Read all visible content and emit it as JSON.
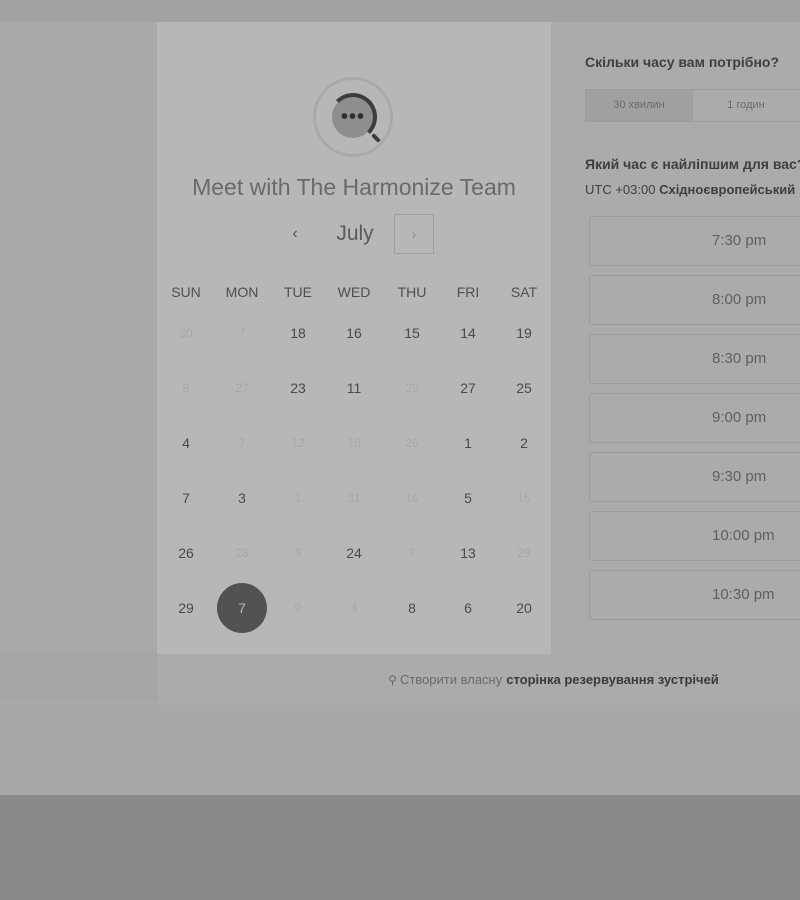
{
  "team_title": "Meet with The Harmonize Team",
  "calendar": {
    "month": "July",
    "prev_icon": "‹",
    "next_icon": "›",
    "weekdays": [
      "SUN",
      "MON",
      "TUE",
      "WED",
      "THU",
      "FRI",
      "SAT"
    ],
    "rows": [
      [
        "30",
        "7",
        "18",
        "16",
        "15",
        "14",
        "19"
      ],
      [
        "8",
        "27",
        "23",
        "11",
        "29",
        "27",
        "25"
      ],
      [
        "4",
        "7",
        "12",
        "18",
        "26",
        "1",
        "2"
      ],
      [
        "7",
        "3",
        "1",
        "31",
        "16",
        "5",
        "15"
      ],
      [
        "26",
        "28",
        "9",
        "24",
        "7",
        "13",
        "29"
      ],
      [
        "29",
        "7",
        "9",
        "4",
        "8",
        "6",
        "20"
      ]
    ],
    "disabled": [
      [
        true,
        true,
        false,
        false,
        false,
        false,
        false
      ],
      [
        true,
        true,
        false,
        false,
        true,
        false,
        false
      ],
      [
        false,
        true,
        true,
        true,
        true,
        false,
        false
      ],
      [
        false,
        false,
        true,
        true,
        true,
        false,
        true
      ],
      [
        false,
        true,
        true,
        false,
        true,
        false,
        true
      ],
      [
        false,
        false,
        true,
        true,
        false,
        false,
        false
      ]
    ],
    "selected": {
      "row": 5,
      "col": 1
    }
  },
  "right_panel": {
    "duration_question": "Скільки часу вам потрібно?",
    "durations": [
      "30 хвилин",
      "1 годин"
    ],
    "active_duration": 0,
    "time_question": "Який час є найліпшим для вас?",
    "timezone_prefix": "UTC +03:00",
    "timezone_name": "Східноєвропейський",
    "time_slots": [
      "7:30 pm",
      "8:00 pm",
      "8:30 pm",
      "9:00 pm",
      "9:30 pm",
      "10:00 pm",
      "10:30 pm"
    ]
  },
  "footer": {
    "icon": "sprocket-icon",
    "prefix": "Створити власну",
    "link": "сторінка резервування зустрічей"
  }
}
